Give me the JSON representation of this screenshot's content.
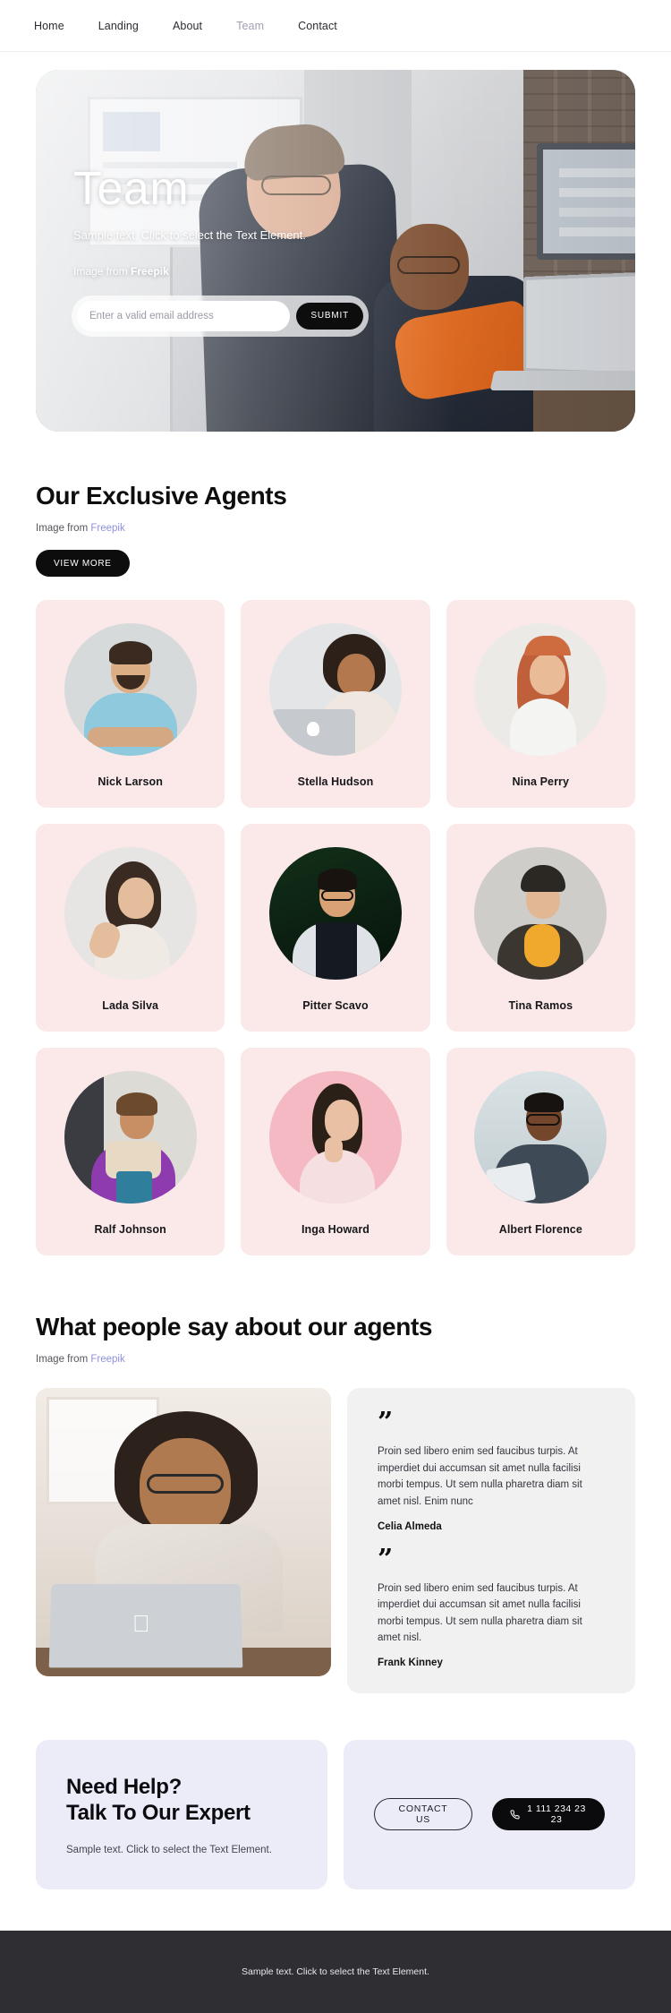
{
  "nav": {
    "items": [
      {
        "label": "Home",
        "active": false
      },
      {
        "label": "Landing",
        "active": false
      },
      {
        "label": "About",
        "active": false
      },
      {
        "label": "Team",
        "active": true
      },
      {
        "label": "Contact",
        "active": false
      }
    ]
  },
  "hero": {
    "title": "Team",
    "subtitle": "Sample text. Click to select the Text Element.",
    "credit_prefix": "Image from ",
    "credit_source": "Freepik",
    "email_placeholder": "Enter a valid email address",
    "email_value": "",
    "submit_label": "SUBMIT"
  },
  "agents_section": {
    "title": "Our Exclusive Agents",
    "credit_prefix": "Image from ",
    "credit_source": "Freepik",
    "view_more_label": "VIEW MORE",
    "cards": [
      {
        "name": "Nick Larson"
      },
      {
        "name": "Stella Hudson"
      },
      {
        "name": "Nina Perry"
      },
      {
        "name": "Lada Silva"
      },
      {
        "name": "Pitter Scavo"
      },
      {
        "name": "Tina Ramos"
      },
      {
        "name": "Ralf Johnson"
      },
      {
        "name": "Inga Howard"
      },
      {
        "name": "Albert Florence"
      }
    ]
  },
  "testimonials_section": {
    "title": "What people say about our agents",
    "credit_prefix": "Image from ",
    "credit_source": "Freepik",
    "quote_glyph": "”",
    "items": [
      {
        "text": "Proin sed libero enim sed faucibus turpis. At imperdiet dui accumsan sit amet nulla facilisi morbi tempus. Ut sem nulla pharetra diam sit amet nisl. Enim nunc",
        "author": "Celia Almeda"
      },
      {
        "text": "Proin sed libero enim sed faucibus turpis. At imperdiet dui accumsan sit amet nulla facilisi morbi tempus. Ut sem nulla pharetra diam sit amet nisl.",
        "author": "Frank Kinney"
      }
    ]
  },
  "cta": {
    "title_line1": "Need Help?",
    "title_line2": "Talk To Our Expert",
    "subtitle": "Sample text. Click to select the Text Element.",
    "contact_label": "CONTACT US",
    "phone_icon": "phone-icon",
    "phone_label": "1 111 234 23 23"
  },
  "footer": {
    "text": "Sample text. Click to select the Text Element."
  },
  "colors": {
    "card_pink": "#fae9e8",
    "cta_lavender": "#ececf8",
    "testimonial_gray": "#f1f1f2",
    "accent_black": "#0d0d0d",
    "link_purple": "#8f8fe0",
    "footer_dark": "#2f2f33"
  }
}
